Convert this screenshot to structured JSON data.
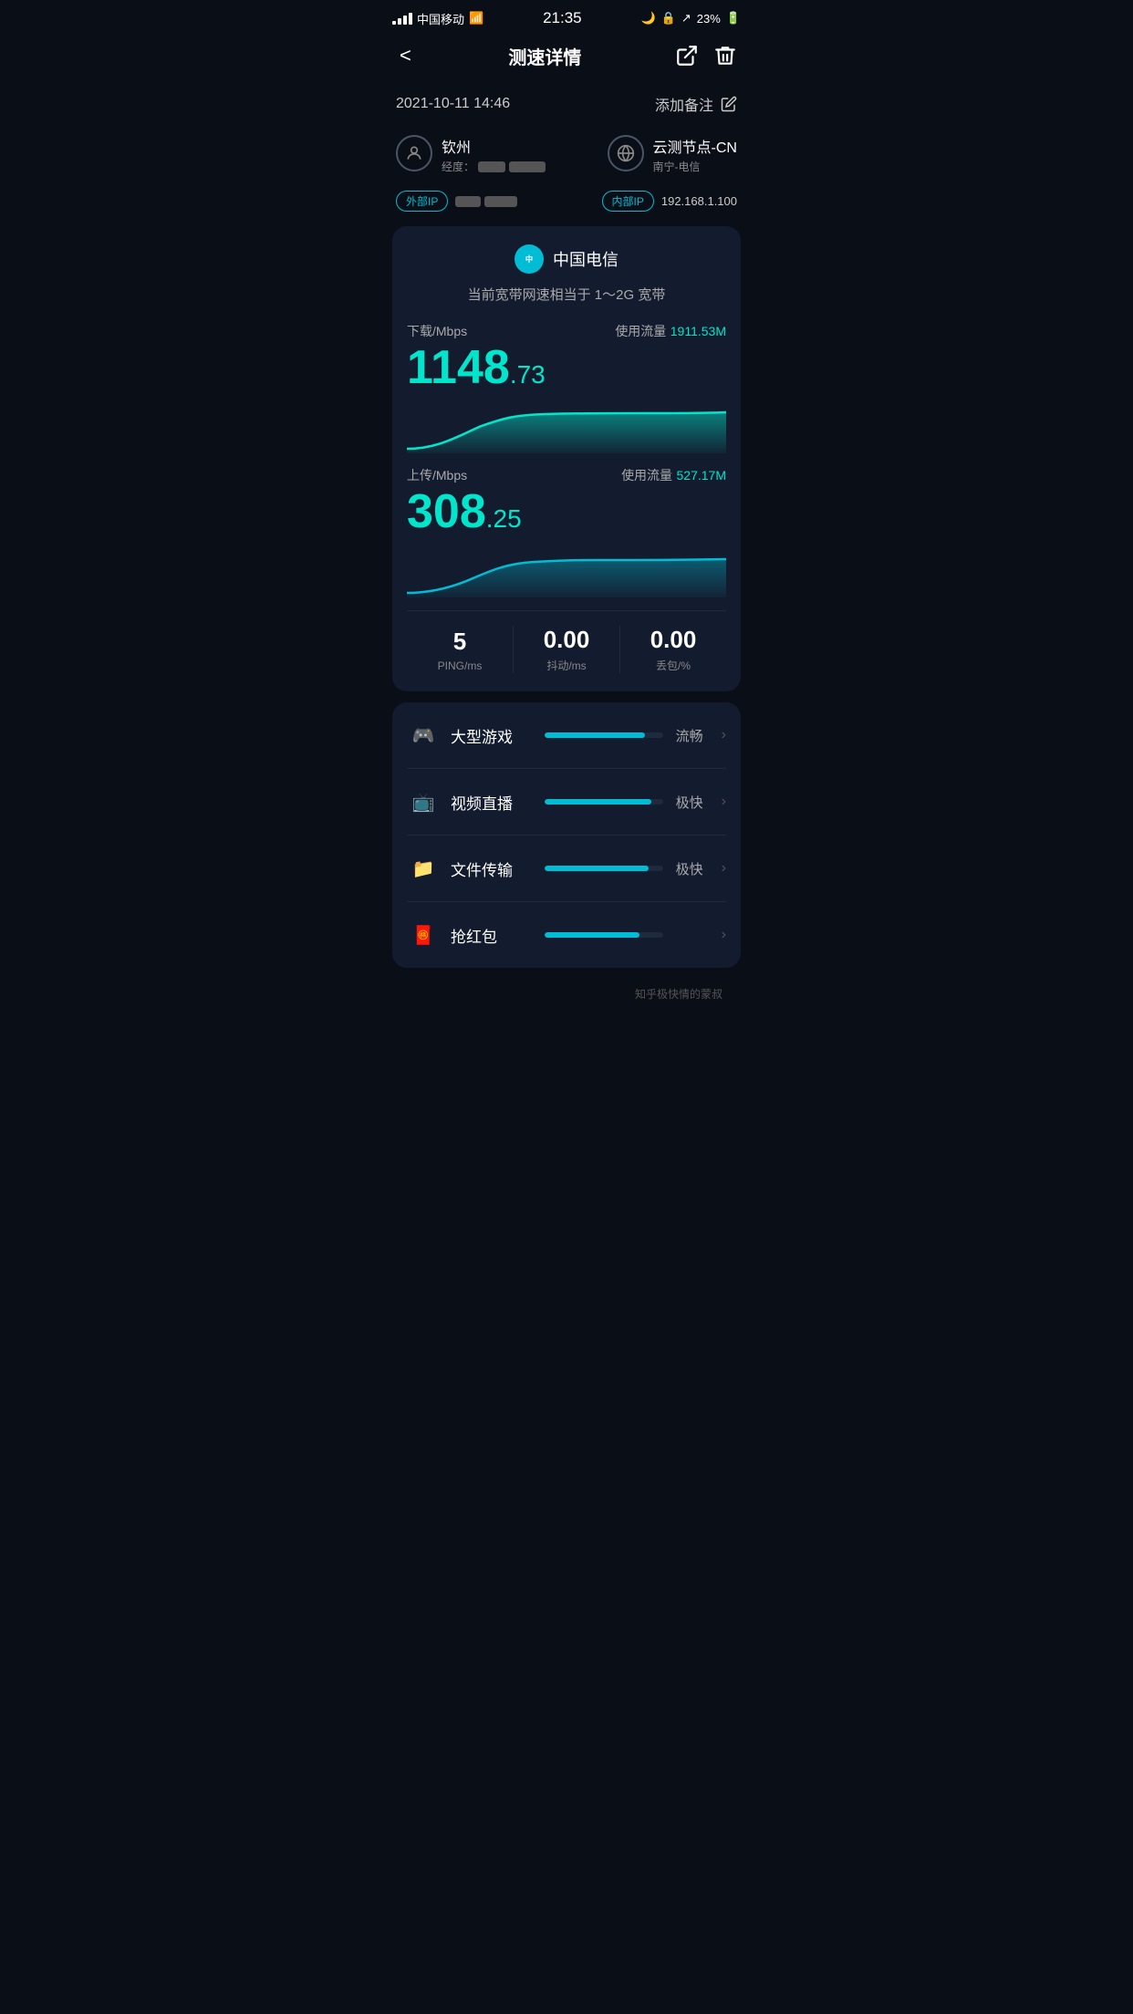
{
  "statusBar": {
    "carrier": "中国移动",
    "time": "21:35",
    "battery": "23%"
  },
  "nav": {
    "back": "<",
    "title": "测速详情",
    "shareLabel": "share",
    "deleteLabel": "delete"
  },
  "dateRow": {
    "datetime": "2021-10-11  14:46",
    "addNote": "添加备注"
  },
  "locationInfo": {
    "name": "钦州",
    "coordLabel": "经度：",
    "serverLabel": "云测节点-CN",
    "serverSub": "南宁-电信"
  },
  "ipRow": {
    "externalLabel": "外部IP",
    "internalLabel": "内部IP",
    "internalValue": "192.168.1.100"
  },
  "speedCard": {
    "isp": "中国电信",
    "description": "当前宽带网速相当于 1～2G 宽带",
    "download": {
      "label": "下载/Mbps",
      "trafficLabel": "使用流量",
      "traffic": "1911.53M",
      "valueMain": "1148",
      "valueDecimal": ".73"
    },
    "upload": {
      "label": "上传/Mbps",
      "trafficLabel": "使用流量",
      "traffic": "527.17M",
      "valueMain": "308",
      "valueDecimal": ".25"
    },
    "ping": {
      "value": "5",
      "label": "PING/ms"
    },
    "jitter": {
      "value": "0.00",
      "label": "抖动/ms"
    },
    "packetLoss": {
      "value": "0.00",
      "label": "丢包/%"
    }
  },
  "usageItems": [
    {
      "icon": "🎮",
      "name": "大型游戏",
      "barPercent": 85,
      "status": "流畅"
    },
    {
      "icon": "📺",
      "name": "视频直播",
      "barPercent": 90,
      "status": "极快"
    },
    {
      "icon": "📁",
      "name": "文件传输",
      "barPercent": 88,
      "status": "极快"
    },
    {
      "icon": "🧧",
      "name": "抢红包",
      "barPercent": 80,
      "status": ""
    }
  ],
  "bottomNote": "知乎极快情的蒙叔"
}
